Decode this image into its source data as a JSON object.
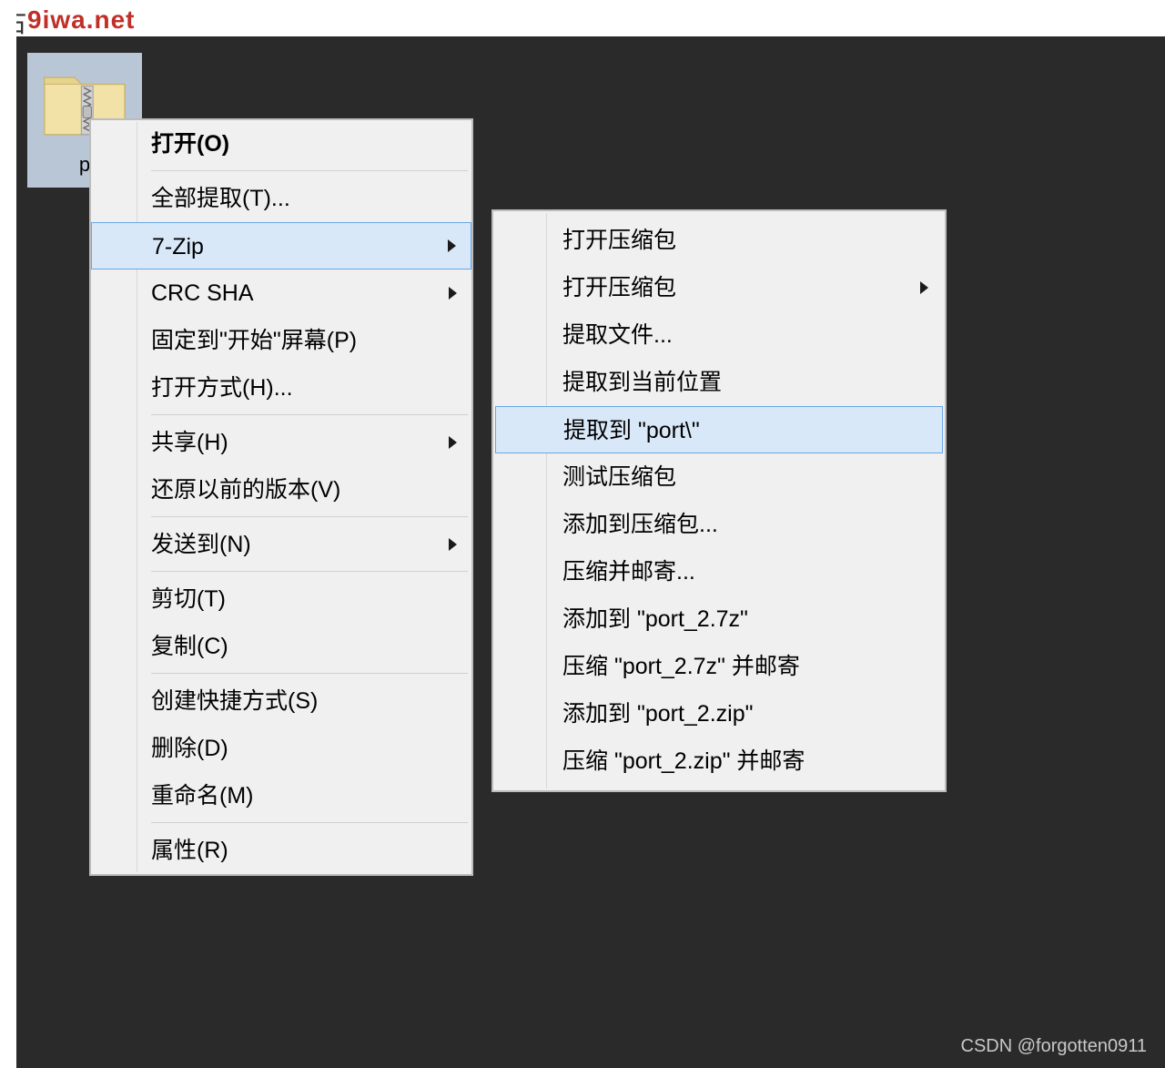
{
  "topMark": "占",
  "watermarkTop": "9iwa.net",
  "file": {
    "label": "p"
  },
  "ctx1": {
    "open": "打开(O)",
    "extractAll": "全部提取(T)...",
    "sevenZip": "7-Zip",
    "crcSha": "CRC SHA",
    "pinStart": "固定到\"开始\"屏幕(P)",
    "openWith": "打开方式(H)...",
    "share": "共享(H)",
    "restorePrev": "还原以前的版本(V)",
    "sendTo": "发送到(N)",
    "cut": "剪切(T)",
    "copy": "复制(C)",
    "createShortcut": "创建快捷方式(S)",
    "delete": "删除(D)",
    "rename": "重命名(M)",
    "properties": "属性(R)"
  },
  "ctx2": {
    "openArchive": "打开压缩包",
    "openArchiveSub": "打开压缩包",
    "extractFiles": "提取文件...",
    "extractHere": "提取到当前位置",
    "extractToFolder": "提取到 \"port\\\"",
    "testArchive": "测试压缩包",
    "addToArchive": "添加到压缩包...",
    "compressEmail": "压缩并邮寄...",
    "addTo7z": "添加到 \"port_2.7z\"",
    "compress7zEmail": "压缩 \"port_2.7z\" 并邮寄",
    "addToZip": "添加到 \"port_2.zip\"",
    "compressZipEmail": "压缩 \"port_2.zip\" 并邮寄"
  },
  "watermarkBottom": "CSDN @forgotten0911"
}
